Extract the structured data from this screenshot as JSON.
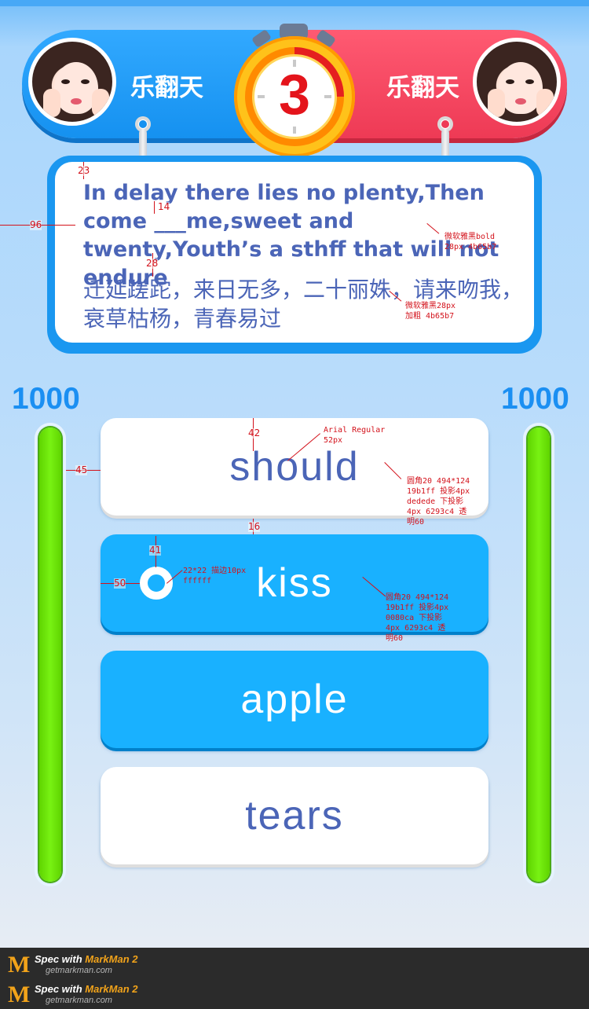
{
  "players": {
    "left": {
      "name": "乐翻天",
      "score": "1000",
      "progress": 1.0
    },
    "right": {
      "name": "乐翻天",
      "score": "1000",
      "progress": 1.0
    }
  },
  "timer": {
    "value": "3"
  },
  "question": {
    "english": "In delay there lies no plenty,Then come ___me,sweet and twenty,Youth’s a sthff that will not endure",
    "chinese": "迁延蹉跎，来日无多，二十丽姝，请来吻我，衰草枯杨，青春易过"
  },
  "answers": [
    {
      "label": "should",
      "style": "white",
      "selected": false
    },
    {
      "label": "kiss",
      "style": "blue",
      "selected": true
    },
    {
      "label": "apple",
      "style": "blue",
      "selected": false
    },
    {
      "label": "tears",
      "style": "white",
      "selected": false
    }
  ],
  "specs": {
    "d23": "23",
    "d14": "14",
    "d96": "96",
    "d28": "28",
    "en_font": "微软雅黑bold\n28px 4b65b7",
    "cn_font": "微软雅黑28px\n加粗 4b65b7",
    "d42": "42",
    "arial": "Arial Regular\n52px",
    "d45": "45",
    "white_btn": "圆角20 494*124\n19b1ff 投影4px\ndedede 下投影\n4px 6293c4 透\n明60",
    "d16": "16",
    "d41": "41",
    "d50": "50",
    "ring": "22*22 描边10px\nffffff",
    "blue_btn": "圆角20 494*124\n19b1ff 投影4px\n0080ca 下投影\n4px 6293c4 透\n明60"
  },
  "footer": {
    "brand_prefix": "Spec with ",
    "brand": "MarkMan 2",
    "site": "getmarkman.com"
  },
  "colors": {
    "text": "#4b65b7",
    "blue": "#19b1ff",
    "red": "#f04560",
    "green": "#6fe10d"
  }
}
